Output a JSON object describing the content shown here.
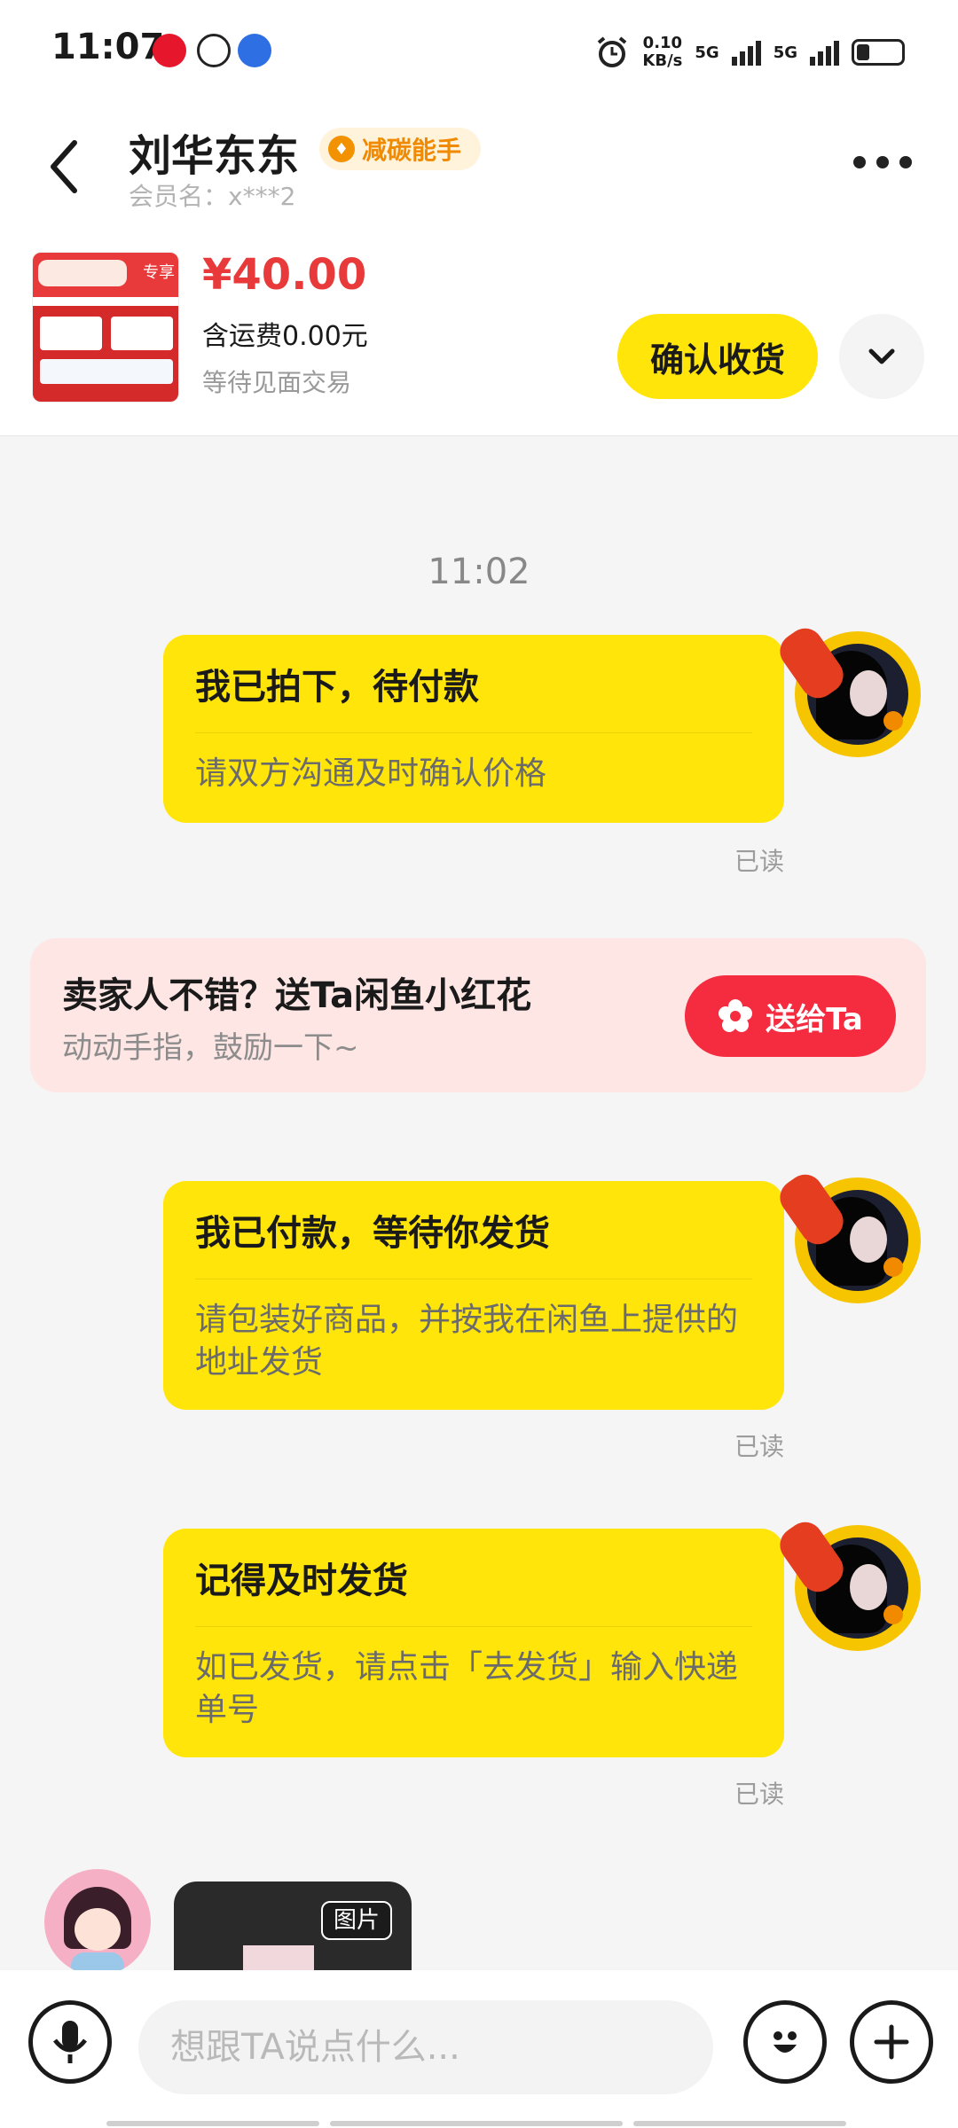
{
  "status_bar": {
    "time": "11:07",
    "speed_value": "0.10",
    "speed_unit": "KB/s",
    "network_1": "5G",
    "network_2": "5G"
  },
  "header": {
    "name": "刘华东东",
    "badge": "减碳能手",
    "member": "会员名：x***2"
  },
  "product": {
    "thumb_tag": "专享",
    "price": "¥40.00",
    "shipping": "含运费0.00元",
    "status": "等待见面交易",
    "confirm_label": "确认收货"
  },
  "chat": {
    "timestamp": "11:02",
    "messages": [
      {
        "title": "我已拍下，待付款",
        "body": "请双方沟通及时确认价格",
        "read": "已读"
      },
      {
        "title": "我已付款，等待你发货",
        "body": "请包装好商品，并按我在闲鱼上提供的地址发货",
        "read": "已读"
      },
      {
        "title": "记得及时发货",
        "body": "如已发货，请点击「去发货」输入快递单号",
        "read": "已读"
      }
    ],
    "flower": {
      "title": "卖家人不错？送Ta闲鱼小红花",
      "subtitle": "动动手指，鼓励一下~",
      "button": "送给Ta"
    },
    "image_tag": "图片"
  },
  "input": {
    "placeholder": "想跟TA说点什么..."
  },
  "icons": {
    "back": "chevron-left-icon",
    "more": "more-dots-icon",
    "expand": "chevron-down-icon",
    "mic": "microphone-icon",
    "emoji": "emoji-icon",
    "plus": "plus-icon"
  },
  "colors": {
    "accent_yellow": "#ffe50a",
    "price_red": "#e83a3a",
    "flower_red": "#f52b40",
    "badge_orange": "#f08a00"
  }
}
